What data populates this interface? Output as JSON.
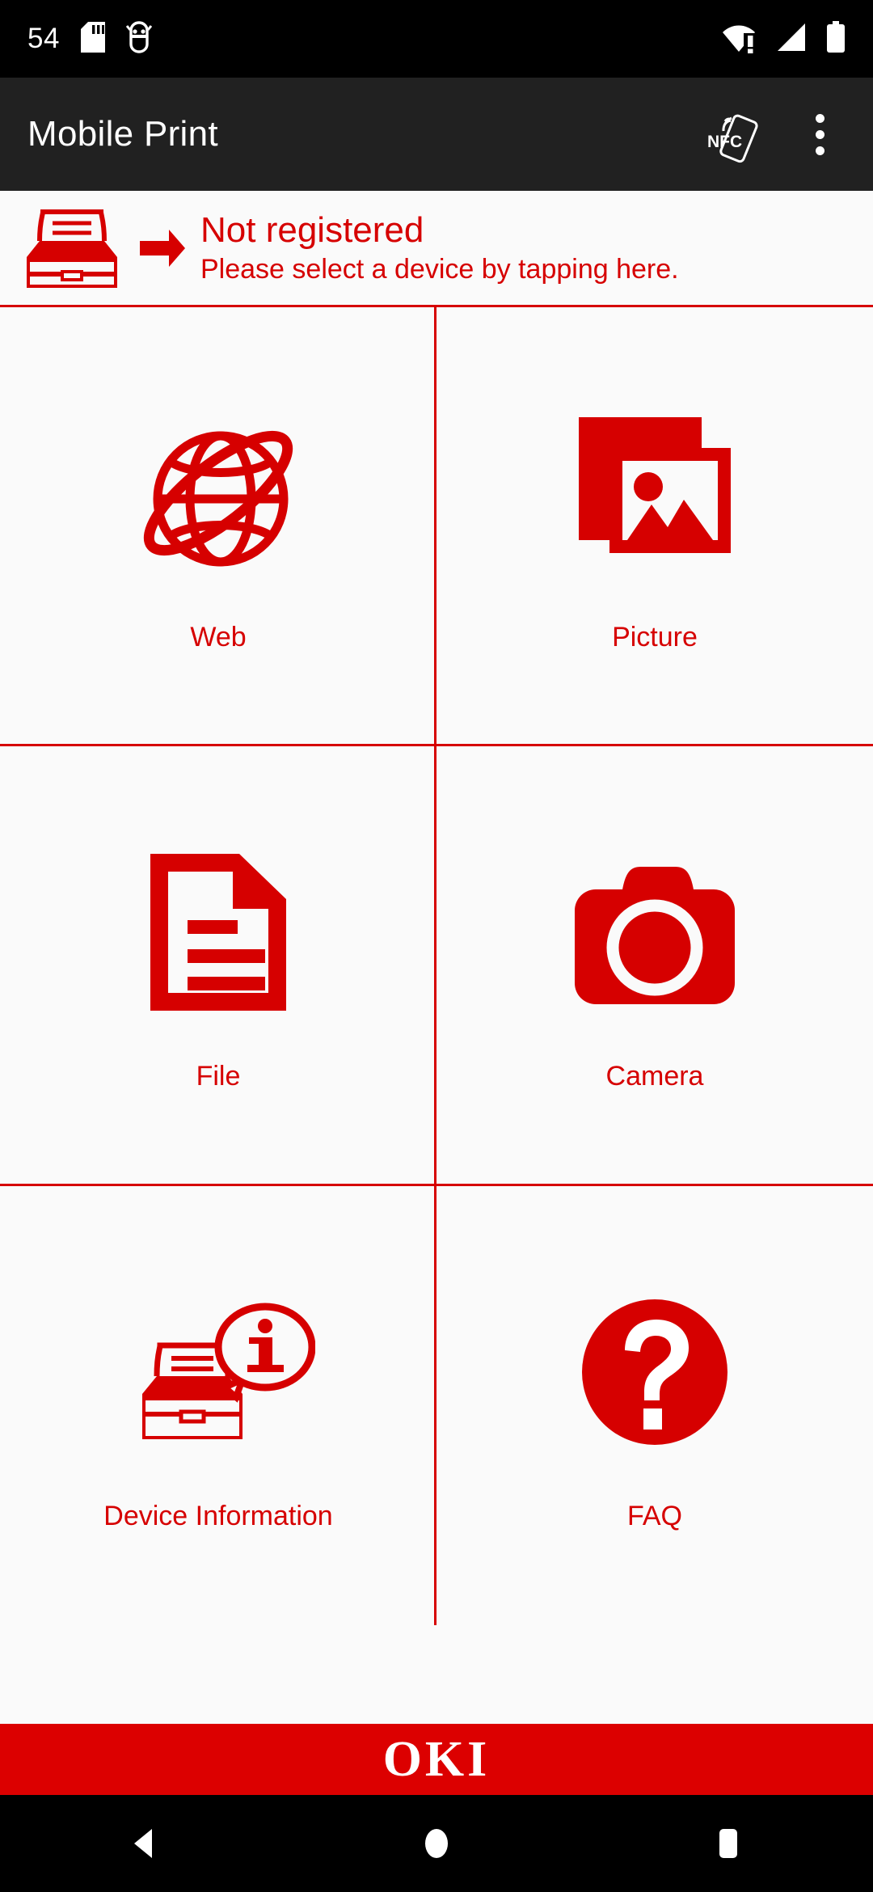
{
  "statusbar": {
    "clock": "54",
    "left_icons": [
      {
        "name": "sd-card-icon"
      },
      {
        "name": "usb-debugging-icon"
      }
    ],
    "right_icons": [
      {
        "name": "wifi-no-internet-icon"
      },
      {
        "name": "cellular-signal-icon"
      },
      {
        "name": "battery-full-icon"
      }
    ]
  },
  "appbar": {
    "title": "Mobile Print",
    "nfc_label": "NFC",
    "nfc_icon": "nfc-icon",
    "overflow_icon": "overflow-menu-icon"
  },
  "device_status": {
    "printer_icon": "printer-icon",
    "arrow_icon": "arrow-right-icon",
    "title": "Not registered",
    "subtitle": "Please select a device by tapping here."
  },
  "grid": {
    "tiles": [
      {
        "label": "Web",
        "icon": "globe-icon"
      },
      {
        "label": "Picture",
        "icon": "picture-icon"
      },
      {
        "label": "File",
        "icon": "document-icon"
      },
      {
        "label": "Camera",
        "icon": "camera-icon"
      },
      {
        "label": "Device Information",
        "icon": "printer-info-icon"
      },
      {
        "label": "FAQ",
        "icon": "question-mark-icon"
      }
    ]
  },
  "footer": {
    "brand": "OKI"
  },
  "navbar": {
    "back": "back-button",
    "home": "home-button",
    "recents": "recents-button"
  },
  "colors": {
    "brand_red": "#D60000",
    "footer_red": "#DC0000",
    "appbar": "#212121",
    "background": "#FAFAFA"
  }
}
